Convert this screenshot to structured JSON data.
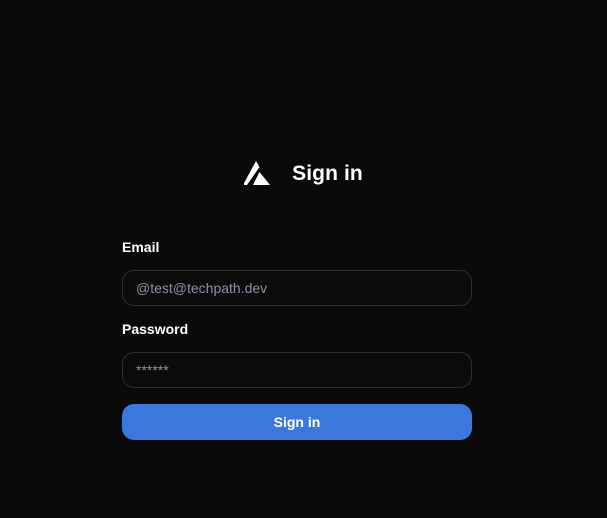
{
  "header": {
    "logo_icon": "triangle-logo-icon",
    "title": "Sign in"
  },
  "form": {
    "email_label": "Email",
    "email_value": "@test@techpath.dev",
    "password_label": "Password",
    "password_value": "******",
    "submit_label": "Sign in"
  },
  "colors": {
    "background": "#0a0a0a",
    "field_border": "#2a2d36",
    "field_text": "#8a93a6",
    "button": "#3b78de"
  }
}
